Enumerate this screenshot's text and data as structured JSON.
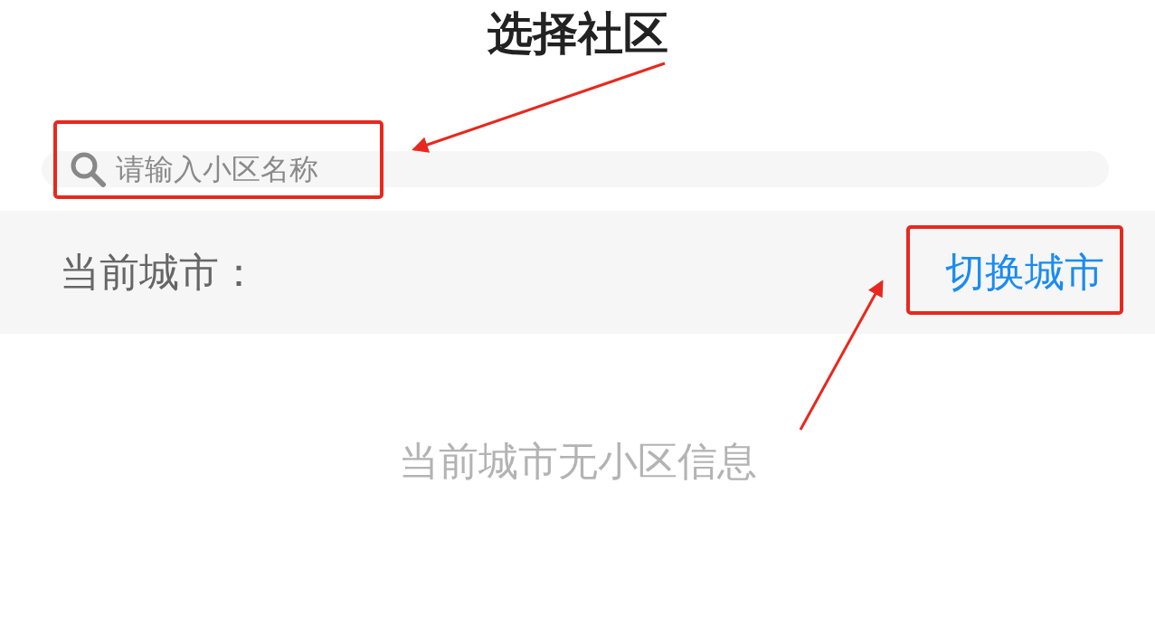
{
  "title": "选择社区",
  "search": {
    "placeholder": "请输入小区名称"
  },
  "city_bar": {
    "label": "当前城市：",
    "switch_link": "切换城市"
  },
  "empty_message": "当前城市无小区信息"
}
